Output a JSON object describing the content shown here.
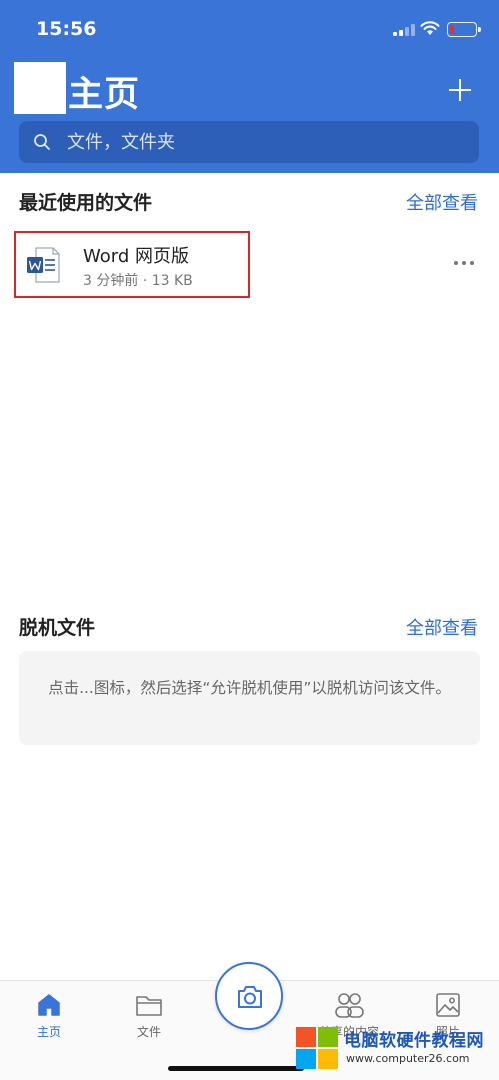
{
  "status": {
    "time": "15:56"
  },
  "header": {
    "title": "主页",
    "search_placeholder": "文件，文件夹"
  },
  "recent": {
    "title": "最近使用的文件",
    "see_all": "全部查看",
    "files": [
      {
        "name": "Word 网页版",
        "meta": "3 分钟前 · 13 KB",
        "icon": "word-icon"
      }
    ]
  },
  "offline": {
    "title": "脱机文件",
    "see_all": "全部查看",
    "message": "点击...图标，然后选择“允许脱机使用”以脱机访问该文件。"
  },
  "tabbar": {
    "tabs": [
      {
        "label": "主页",
        "icon": "home-icon",
        "active": true
      },
      {
        "label": "文件",
        "icon": "folder-icon",
        "active": false
      },
      {
        "label": "共享的内容",
        "icon": "people-icon",
        "active": false
      },
      {
        "label": "照片",
        "icon": "photo-icon",
        "active": false
      }
    ],
    "camera_icon": "camera-icon"
  },
  "watermark": {
    "title": "电脑软硬件教程网",
    "url": "www.computer26.com"
  },
  "colors": {
    "accent": "#3a74d6",
    "link": "#2f6fd1",
    "highlight_border": "#d9262b",
    "battery_low": "#e6302d"
  }
}
